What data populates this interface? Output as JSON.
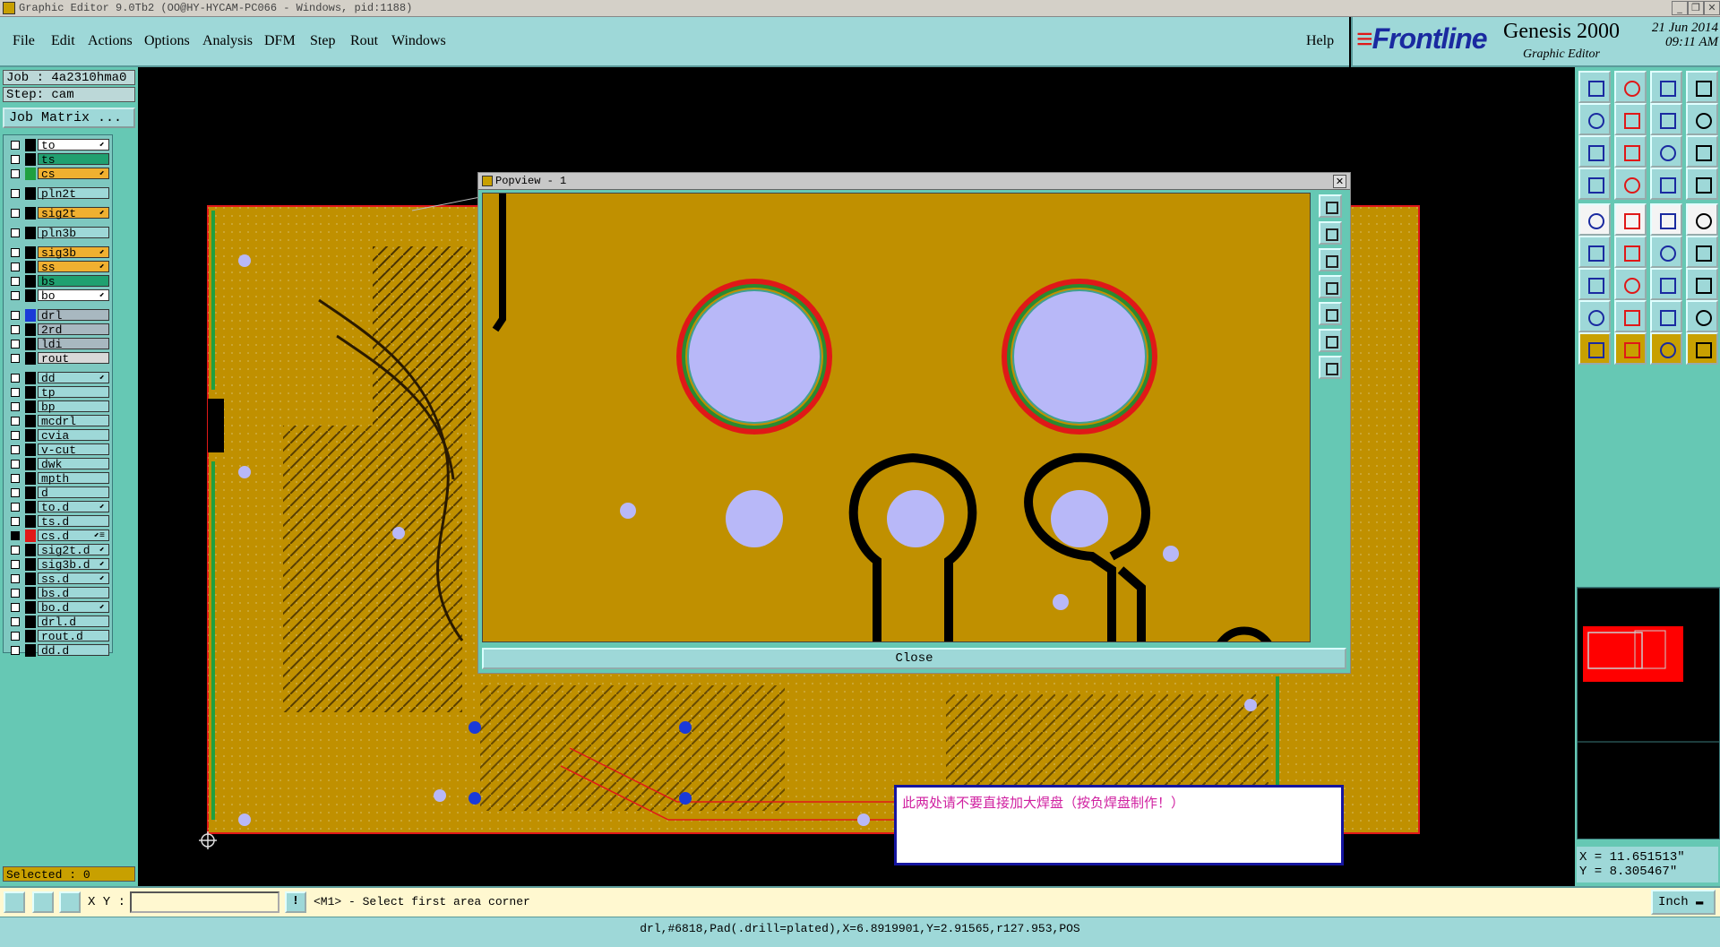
{
  "window": {
    "title": "Graphic Editor 9.0Tb2 (OO@HY-HYCAM-PC066 - Windows, pid:1188)",
    "controls": [
      "_",
      "❐",
      "✕"
    ]
  },
  "menu": {
    "items": [
      "File",
      "Edit",
      "Actions",
      "Options",
      "Analysis",
      "DFM",
      "Step",
      "Rout",
      "Windows"
    ],
    "help": "Help"
  },
  "brand": {
    "logo": "Frontline",
    "product": "Genesis 2000",
    "subtitle": "Graphic Editor",
    "date": "21 Jun 2014",
    "time": "09:11 AM"
  },
  "job": {
    "job_label": "Job : 4a2310hma0",
    "step_label": "Step: cam",
    "matrix_button": "Job Matrix ...",
    "selected": "Selected : 0"
  },
  "layers": [
    {
      "name": "to",
      "bg": "#ffffff",
      "swatch": "#000000",
      "flag": "⬋"
    },
    {
      "name": "ts",
      "bg": "#20a070",
      "swatch": "#000000",
      "flag": ""
    },
    {
      "name": "cs",
      "bg": "#f0b030",
      "swatch": "#20a040",
      "flag": "⬋"
    },
    {
      "name": "pln2t",
      "bg": "#9ed8d8",
      "swatch": "#000000",
      "flag": ""
    },
    {
      "name": "sig2t",
      "bg": "#f0b030",
      "swatch": "#000000",
      "flag": "⬋"
    },
    {
      "name": "pln3b",
      "bg": "#9ed8d8",
      "swatch": "#000000",
      "flag": ""
    },
    {
      "name": "sig3b",
      "bg": "#f0b030",
      "swatch": "#000000",
      "flag": "⬋"
    },
    {
      "name": "ss",
      "bg": "#f0b030",
      "swatch": "#000000",
      "flag": "⬋"
    },
    {
      "name": "bs",
      "bg": "#20a070",
      "swatch": "#000000",
      "flag": ""
    },
    {
      "name": "bo",
      "bg": "#ffffff",
      "swatch": "#000000",
      "flag": "⬋"
    },
    {
      "name": "drl",
      "bg": "#a8b8c0",
      "swatch": "#1a3ad8",
      "flag": ""
    },
    {
      "name": "2rd",
      "bg": "#a8b8c0",
      "swatch": "#000000",
      "flag": ""
    },
    {
      "name": "ldi",
      "bg": "#a8b8c0",
      "swatch": "#000000",
      "flag": ""
    },
    {
      "name": "rout",
      "bg": "#d8d8d8",
      "swatch": "#000000",
      "flag": ""
    },
    {
      "name": "dd",
      "bg": "#9ed8d8",
      "swatch": "#000000",
      "flag": "⬋"
    },
    {
      "name": "tp",
      "bg": "#9ed8d8",
      "swatch": "#000000",
      "flag": ""
    },
    {
      "name": "bp",
      "bg": "#9ed8d8",
      "swatch": "#000000",
      "flag": ""
    },
    {
      "name": "mcdrl",
      "bg": "#9ed8d8",
      "swatch": "#000000",
      "flag": ""
    },
    {
      "name": "cvia",
      "bg": "#9ed8d8",
      "swatch": "#000000",
      "flag": ""
    },
    {
      "name": "v-cut",
      "bg": "#9ed8d8",
      "swatch": "#000000",
      "flag": ""
    },
    {
      "name": "dwk",
      "bg": "#9ed8d8",
      "swatch": "#000000",
      "flag": ""
    },
    {
      "name": "mpth",
      "bg": "#9ed8d8",
      "swatch": "#000000",
      "flag": ""
    },
    {
      "name": "d",
      "bg": "#9ed8d8",
      "swatch": "#000000",
      "flag": ""
    },
    {
      "name": "to.d",
      "bg": "#9ed8d8",
      "swatch": "#000000",
      "flag": "⬋"
    },
    {
      "name": "ts.d",
      "bg": "#9ed8d8",
      "swatch": "#000000",
      "flag": ""
    },
    {
      "name": "cs.d",
      "bg": "#9ed8d8",
      "swatch": "#e01818",
      "flag": "⬋≡",
      "active": true
    },
    {
      "name": "sig2t.d",
      "bg": "#9ed8d8",
      "swatch": "#000000",
      "flag": "⬋"
    },
    {
      "name": "sig3b.d",
      "bg": "#9ed8d8",
      "swatch": "#000000",
      "flag": "⬋"
    },
    {
      "name": "ss.d",
      "bg": "#9ed8d8",
      "swatch": "#000000",
      "flag": "⬋"
    },
    {
      "name": "bs.d",
      "bg": "#9ed8d8",
      "swatch": "#000000",
      "flag": ""
    },
    {
      "name": "bo.d",
      "bg": "#9ed8d8",
      "swatch": "#000000",
      "flag": "⬋"
    },
    {
      "name": "drl.d",
      "bg": "#9ed8d8",
      "swatch": "#000000",
      "flag": ""
    },
    {
      "name": "rout.d",
      "bg": "#9ed8d8",
      "swatch": "#000000",
      "flag": ""
    },
    {
      "name": "dd.d",
      "bg": "#9ed8d8",
      "swatch": "#000000",
      "flag": ""
    }
  ],
  "popview": {
    "title": "Popview - 1",
    "close_button": "Close"
  },
  "note": {
    "text": "此两处请不要直接加大焊盘（按负焊盘制作！）"
  },
  "coords": {
    "x": "X = 11.651513\"",
    "y": "Y = 8.305467\""
  },
  "status": {
    "xy_label": "X Y :",
    "xy_value": "",
    "prompt": "<M1> - Select first area corner",
    "unit": "Inch",
    "info": "drl,#6818,Pad(.drill=plated),X=6.8919901,Y=2.91565,r127.953,POS"
  },
  "colors": {
    "panel": "#66c8b4",
    "button": "#9ed8d8",
    "board": "#c09000",
    "copper_outline": "#e01818",
    "pad": "#b8b8f8"
  }
}
